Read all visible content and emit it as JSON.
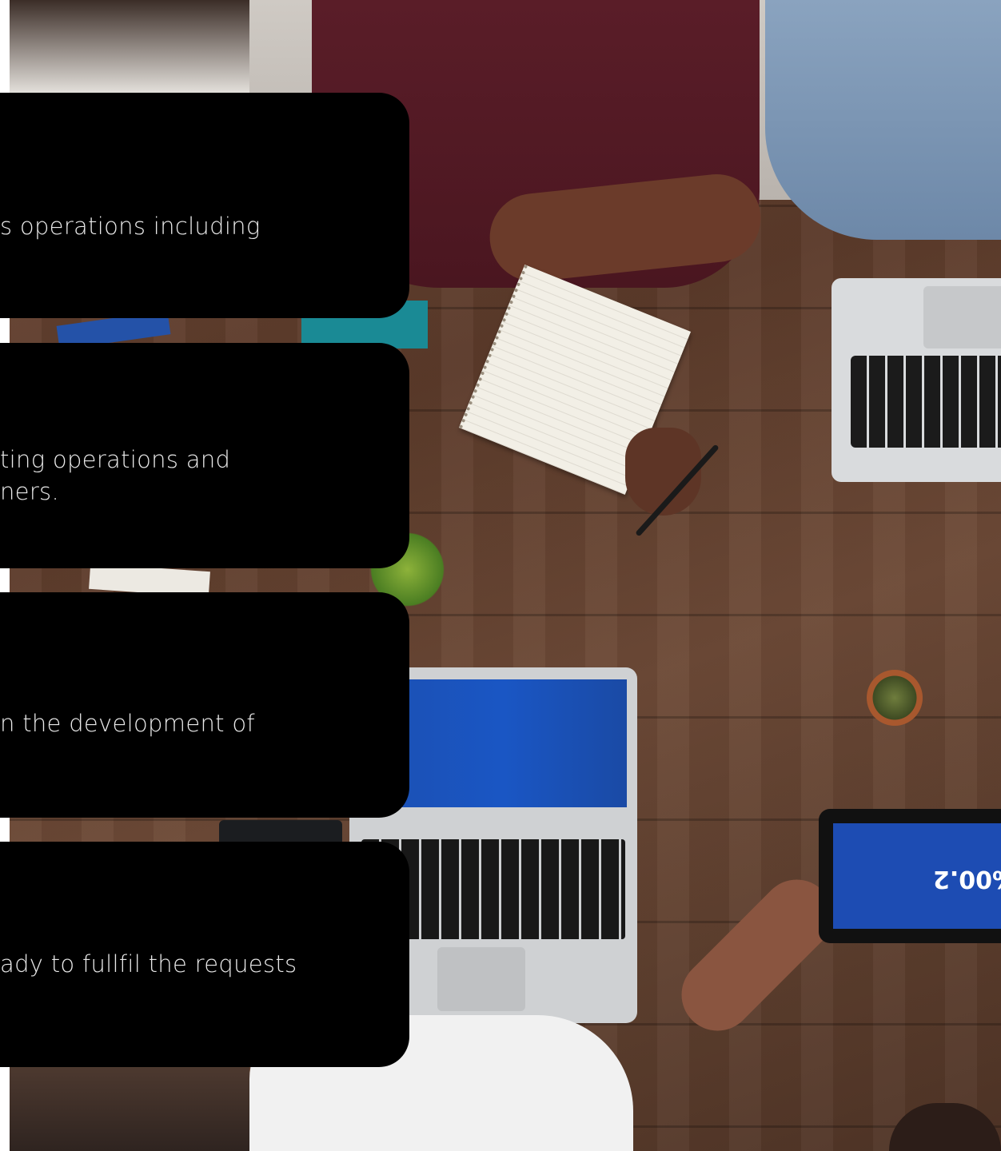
{
  "background": {
    "tablet_readout": "%00.2"
  },
  "cards": [
    {
      "lines": [
        "s operations including"
      ]
    },
    {
      "lines": [
        "ting operations and",
        "ners."
      ]
    },
    {
      "lines": [
        "n the development of"
      ]
    },
    {
      "lines": [
        "ady to fullfil the requests"
      ]
    }
  ],
  "colors": {
    "card_background": "#000000",
    "card_text": "#e9e9e9"
  }
}
